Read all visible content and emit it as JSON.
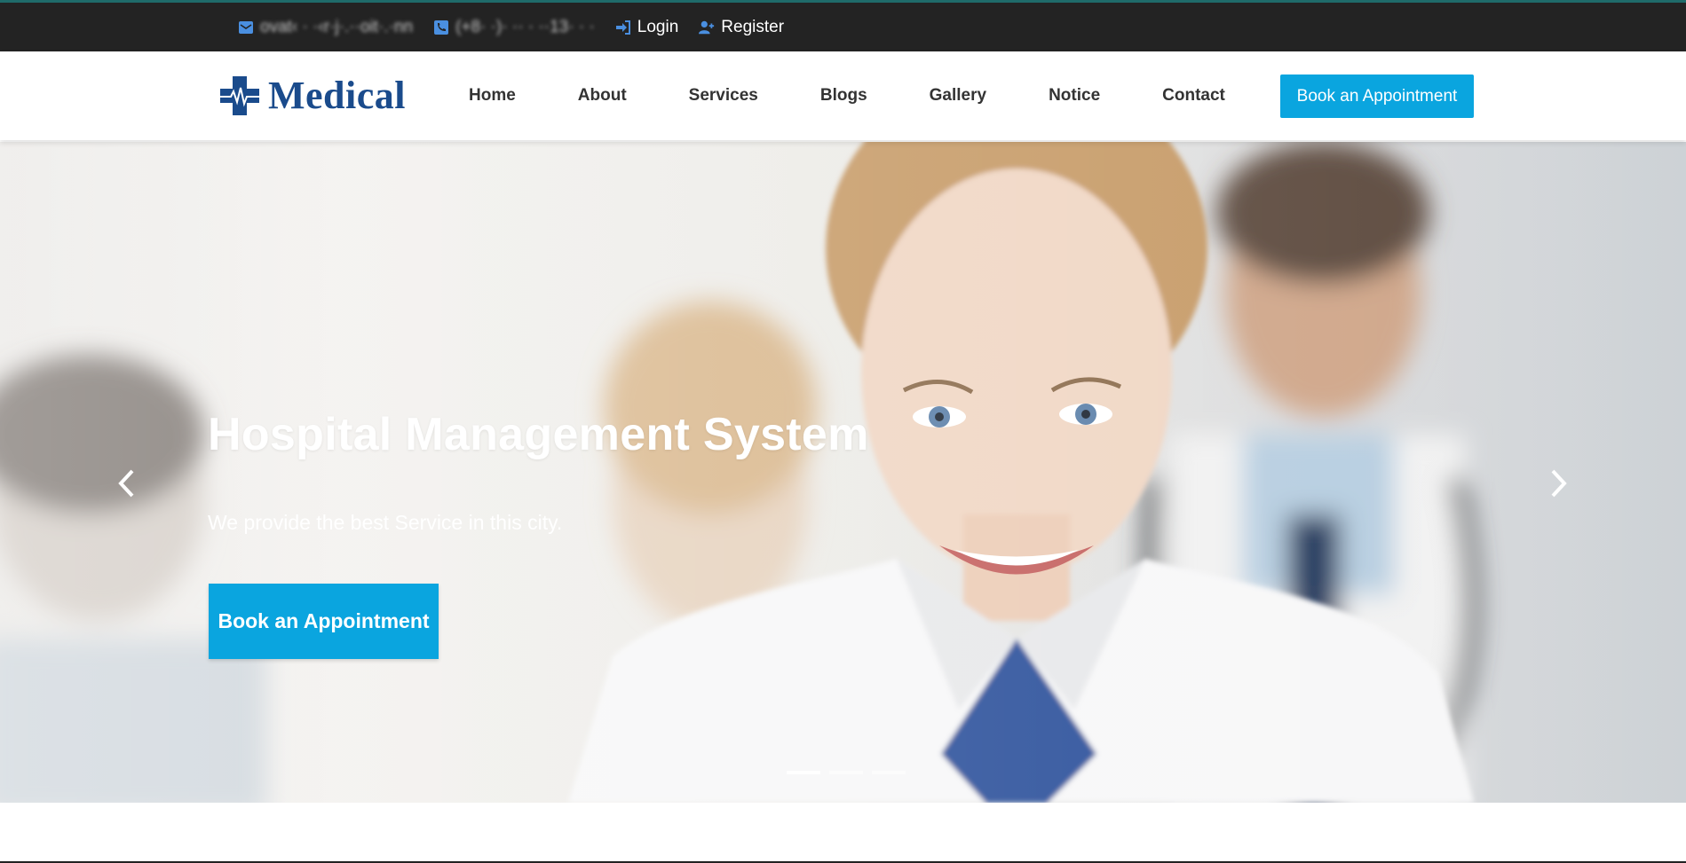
{
  "topbar": {
    "email": "ovat‹ · ·‹r·j·.··oit·.·nn",
    "phone": "(+8· ·)· ·· · ··13· · ·",
    "login_label": "Login",
    "register_label": "Register",
    "icons": [
      "envelope-icon",
      "phone-icon",
      "sign-in-icon",
      "user-plus-icon"
    ],
    "icon_color": "#4a8fe0"
  },
  "header": {
    "logo_text": "Medical",
    "nav": [
      {
        "label": "Home"
      },
      {
        "label": "About"
      },
      {
        "label": "Services"
      },
      {
        "label": "Blogs"
      },
      {
        "label": "Gallery"
      },
      {
        "label": "Notice"
      },
      {
        "label": "Contact"
      }
    ],
    "cta_label": "Book an Appointment"
  },
  "hero": {
    "title": "Hospital Management System",
    "subtitle": "We provide the best Service in this city.",
    "cta_label": "Book an Appointment",
    "slides_count": 3,
    "active_slide": 1
  },
  "colors": {
    "accent": "#0aa5df",
    "brand": "#1a4b8c",
    "topbar_bg": "#232323",
    "accent_line": "#1f6b6a"
  }
}
